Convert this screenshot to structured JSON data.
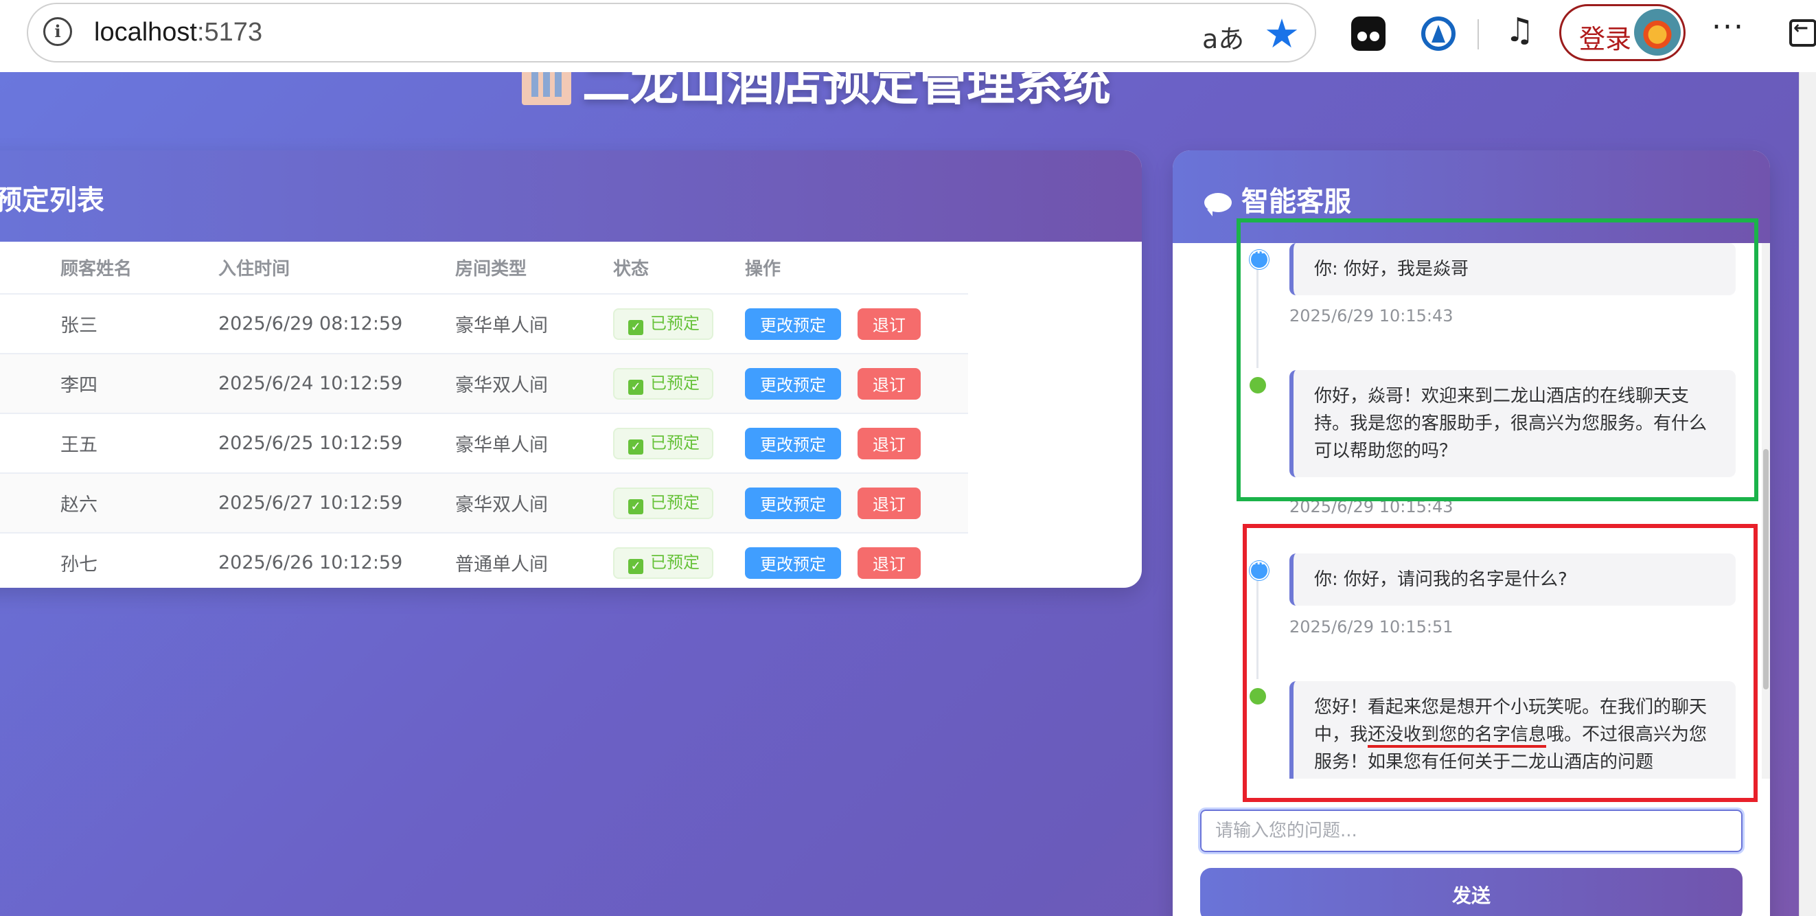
{
  "browser": {
    "url_host": "localhost",
    "url_port": ":5173",
    "translate_glyph": "aあ",
    "login_label": "登录",
    "more_glyph": "···",
    "star_glyph": "★",
    "music_glyph": "♫"
  },
  "page": {
    "title": "二龙山酒店预定管理系统"
  },
  "reservations": {
    "title": "预定列表",
    "columns": [
      "",
      "顾客姓名",
      "入住时间",
      "房间类型",
      "状态",
      "操作"
    ],
    "edit_label": "更改预定",
    "cancel_label": "退订",
    "rows": [
      {
        "name": "张三",
        "checkin": "2025/6/29 08:12:59",
        "room": "豪华单人间",
        "status": "已预定"
      },
      {
        "name": "李四",
        "checkin": "2025/6/24 10:12:59",
        "room": "豪华双人间",
        "status": "已预定"
      },
      {
        "name": "王五",
        "checkin": "2025/6/25 10:12:59",
        "room": "豪华单人间",
        "status": "已预定"
      },
      {
        "name": "赵六",
        "checkin": "2025/6/27 10:12:59",
        "room": "豪华双人间",
        "status": "已预定"
      },
      {
        "name": "孙七",
        "checkin": "2025/6/26 10:12:59",
        "room": "普通单人间",
        "status": "已预定"
      }
    ]
  },
  "chat": {
    "title": "智能客服",
    "messages": [
      {
        "role": "user",
        "text": "你: 你好，我是焱哥",
        "time": "2025/6/29 10:15:43"
      },
      {
        "role": "bot",
        "text": "你好，焱哥！欢迎来到二龙山酒店的在线聊天支持。我是您的客服助手，很高兴为您服务。有什么可以帮助您的吗？",
        "time": "2025/6/29 10:15:43"
      },
      {
        "role": "user",
        "text": "你: 你好，请问我的名字是什么?",
        "time": "2025/6/29 10:15:51"
      },
      {
        "role": "bot",
        "text_pre": "您好！看起来您是想开个小玩笑呢。在我们的聊天中，我",
        "text_highlight": "还没收到您的名字信息",
        "text_post": "哦。不过很高兴为您服务！如果您有任何关于二龙山酒店的问题"
      }
    ],
    "input_placeholder": "请输入您的问题...",
    "send_label": "发送"
  },
  "annotations": {
    "box_colors": {
      "green": "#1bb34a",
      "red": "#e8202a"
    },
    "underline_color": "#e02020"
  }
}
